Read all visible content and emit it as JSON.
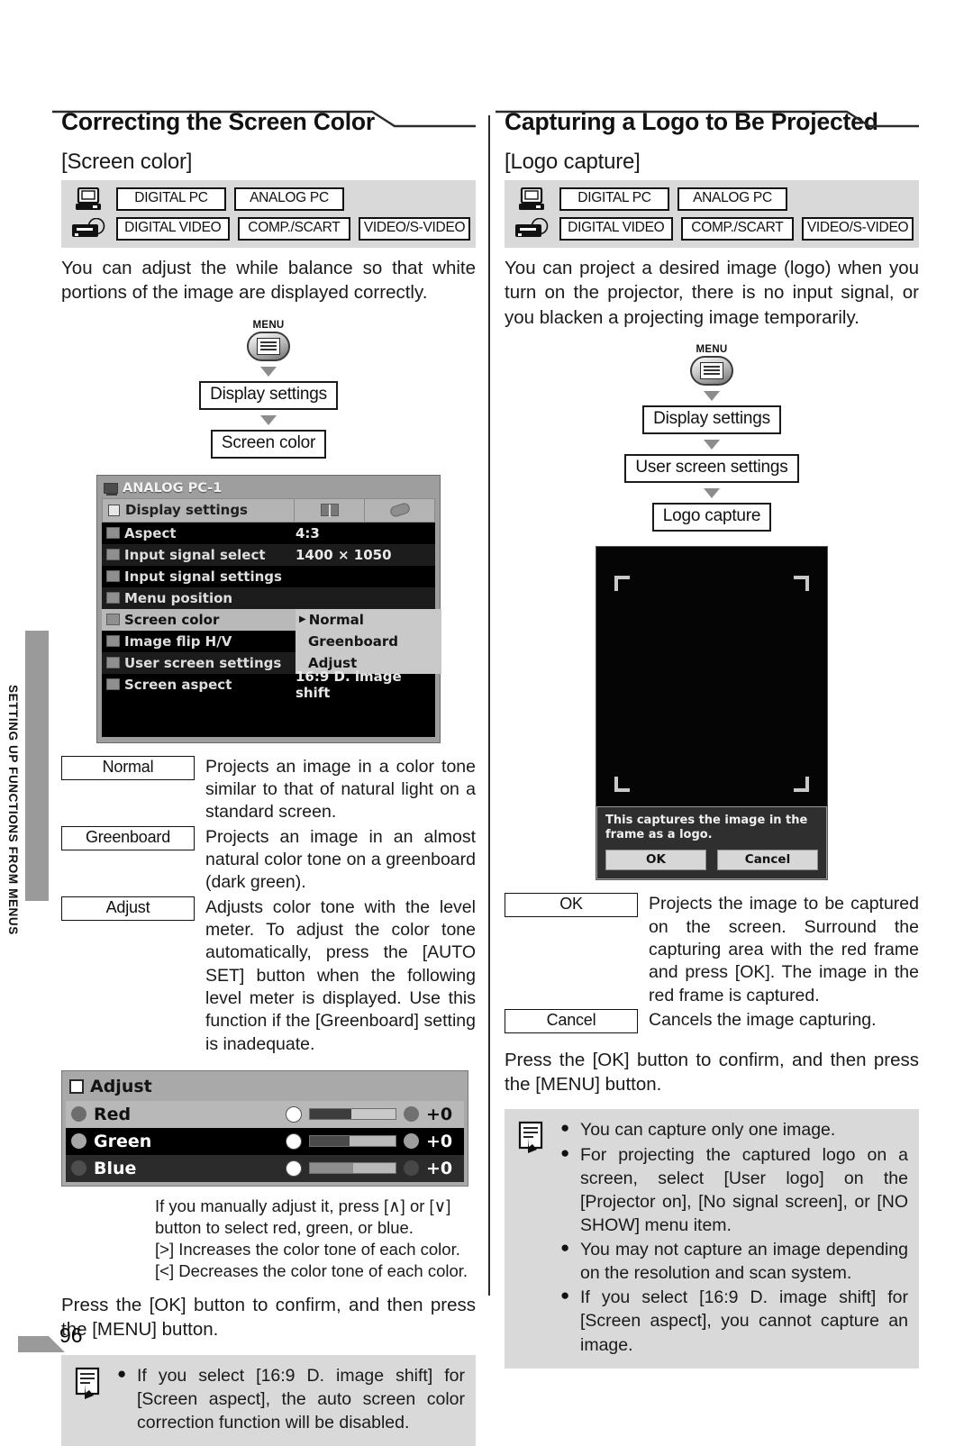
{
  "page": {
    "number": "96",
    "side_tab_label": "SETTING UP FUNCTIONS FROM MENUS"
  },
  "left": {
    "title": "Correcting the Screen Color",
    "subtitle": "[Screen color]",
    "badges": {
      "pc_icon": "desktop-computer-icon",
      "video_icon": "video-deck-icon",
      "row1": [
        "DIGITAL PC",
        "ANALOG PC"
      ],
      "row2": [
        "DIGITAL VIDEO",
        "COMP./SCART",
        "VIDEO/S-VIDEO"
      ]
    },
    "intro": "You can adjust the while balance so that white portions of the image are displayed correctly.",
    "flow": {
      "menu_caption": "MENU",
      "menu_icon": "menu-button-icon",
      "steps": [
        "Display settings",
        "Screen color"
      ]
    },
    "osd": {
      "source_title": "ANALOG PC-1",
      "tab_label": "Display settings",
      "tab_icons": [
        "book-icon",
        "wrench-icon"
      ],
      "rows": [
        {
          "label": "Aspect",
          "value": "4:3"
        },
        {
          "label": "Input signal select",
          "value": "1400 × 1050"
        },
        {
          "label": "Input signal settings",
          "value": ""
        },
        {
          "label": "Menu position",
          "value": ""
        },
        {
          "label": "Screen color",
          "value": ""
        },
        {
          "label": "Image flip H/V",
          "value": ""
        },
        {
          "label": "User screen settings",
          "value": ""
        },
        {
          "label": "Screen aspect",
          "value": "16:9 D. image shift"
        }
      ],
      "submenu": [
        "Normal",
        "Greenboard",
        "Adjust"
      ],
      "submenu_selected": "Normal"
    },
    "options": [
      {
        "key": "Normal",
        "desc": "Projects an image in a color tone similar to that of natural light on a standard screen."
      },
      {
        "key": "Greenboard",
        "desc": "Projects an image in an almost natural color tone on a greenboard (dark green)."
      },
      {
        "key": "Adjust",
        "desc": "Adjusts color tone with the level meter. To adjust the color tone automatically, press the [AUTO SET] button when the following level meter is displayed. Use this function if the [Greenboard] setting is inadequate."
      }
    ],
    "adjust_panel": {
      "title": "Adjust",
      "rows": [
        {
          "name": "Red",
          "value": "+0",
          "fill_pct": 48
        },
        {
          "name": "Green",
          "value": "+0",
          "fill_pct": 46
        },
        {
          "name": "Blue",
          "value": "+0",
          "fill_pct": 50
        }
      ]
    },
    "adjust_notes": [
      "If you manually adjust it, press [∧] or [∨] button to select red, green, or blue.",
      "[>] Increases the color tone of each color.",
      "[<] Decreases the color tone of each color."
    ],
    "confirm_text": "Press the [OK] button to confirm, and then press the [MENU] button.",
    "note": {
      "icon": "note-memo-icon",
      "bullet": "●",
      "items": [
        "If you select [16:9 D. image shift] for [Screen aspect], the auto screen color correction function will be disabled."
      ]
    }
  },
  "right": {
    "title": "Capturing a Logo to Be Projected",
    "subtitle": "[Logo capture]",
    "badges": {
      "pc_icon": "desktop-computer-icon",
      "video_icon": "video-deck-icon",
      "row1": [
        "DIGITAL PC",
        "ANALOG PC"
      ],
      "row2": [
        "DIGITAL VIDEO",
        "COMP./SCART",
        "VIDEO/S-VIDEO"
      ]
    },
    "intro": "You can project a desired image (logo) when you turn on the projector, there is no input signal, or you blacken a projecting image temporarily.",
    "flow": {
      "menu_caption": "MENU",
      "menu_icon": "menu-button-icon",
      "steps": [
        "Display settings",
        "User screen settings",
        "Logo capture"
      ]
    },
    "capture_screen": {
      "dialog_text": "This captures the image in the frame as a logo.",
      "ok_label": "OK",
      "cancel_label": "Cancel"
    },
    "options": [
      {
        "key": "OK",
        "desc": "Projects the image to be captured on the screen. Surround the capturing area with the red frame and press [OK]. The image in the red frame is captured."
      },
      {
        "key": "Cancel",
        "desc": "Cancels the image capturing."
      }
    ],
    "confirm_text": "Press the [OK] button to confirm, and then press the [MENU] button.",
    "note": {
      "icon": "note-memo-icon",
      "bullet": "●",
      "items": [
        "You can capture only one image.",
        "For projecting the captured logo on a screen, select [User logo] on the [Projector on], [No signal screen], or [NO SHOW] menu item.",
        "You may not capture an image depending on the resolution and scan system.",
        "If you select [16:9 D. image shift] for [Screen aspect], you cannot capture an image."
      ]
    }
  }
}
